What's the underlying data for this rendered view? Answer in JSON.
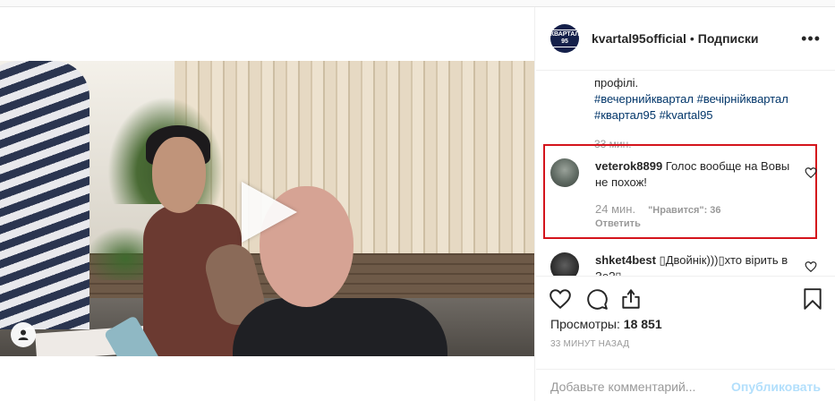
{
  "header": {
    "avatar_text": "КВАРТАЛ 95",
    "username": "kvartal95official",
    "separator": "•",
    "follow_status": "Подписки",
    "more_icon": "more-horizontal-icon"
  },
  "caption": {
    "text_line": "профілі.",
    "hashtags": [
      "#вечернийквартал",
      "#вечірнійквартал",
      "#квартал95",
      "#kvartal95"
    ],
    "time": "33 мин."
  },
  "comments": [
    {
      "username": "veterok8899",
      "text": " Голос вообще на Вовы не похож!",
      "time": "24 мин.",
      "likes": "\"Нравится\": 36",
      "reply": "Ответить",
      "highlighted": true
    },
    {
      "username": "shket4best",
      "text": " ▯Двойнік)))▯хто вірить в Зе?▯",
      "highlighted": false
    }
  ],
  "actions": {
    "like_icon": "heart-icon",
    "comment_icon": "comment-bubble-icon",
    "share_icon": "share-arrow-icon",
    "save_icon": "bookmark-icon"
  },
  "stats": {
    "views_label": "Просмотры:",
    "views_value": "18 851",
    "posted": "33 МИНУТ НАЗАД"
  },
  "comment_box": {
    "placeholder": "Добавьте комментарий...",
    "publish_label": "Опубликовать"
  },
  "colors": {
    "highlight": "#d4141c",
    "hashtag": "#003569",
    "publish_disabled": "#b2dffc"
  }
}
